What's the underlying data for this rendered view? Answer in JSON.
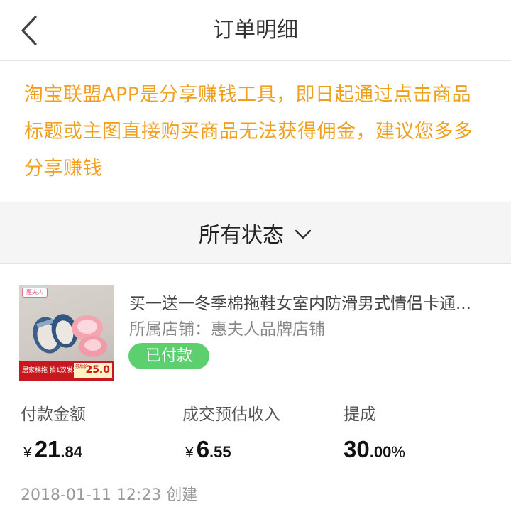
{
  "nav": {
    "title": "订单明细"
  },
  "notice": {
    "text": "淘宝联盟APP是分享赚钱工具，即日起通过点击商品标题或主图直接购买商品无法获得佣金，建议您多多分享赚钱"
  },
  "filter": {
    "label": "所有状态"
  },
  "order": {
    "thumb": {
      "brand": "惠夫人",
      "banner": "居家棉拖 拍1双发2双",
      "price_note": "券后价",
      "price": "25.0"
    },
    "title": "买一送一冬季棉拖鞋女室内防滑男式情侣卡通...",
    "shop": "所属店铺：惠夫人品牌店铺",
    "status": "已付款",
    "payment": {
      "label": "付款金额",
      "currency": "¥",
      "int": "21",
      "dec": ".84"
    },
    "income": {
      "label": "成交预估收入",
      "currency": "¥",
      "int": "6",
      "dec": ".55"
    },
    "rate": {
      "label": "提成",
      "int": "30",
      "dec": ".00",
      "unit": "%"
    },
    "created": "2018-01-11 12:23 创建"
  },
  "colors": {
    "notice": "#f0a020",
    "status_bg": "#5cd06f",
    "banner": "#c8171e"
  },
  "icons": {
    "back": "chevron-left-icon",
    "filter_toggle": "chevron-down-icon"
  }
}
